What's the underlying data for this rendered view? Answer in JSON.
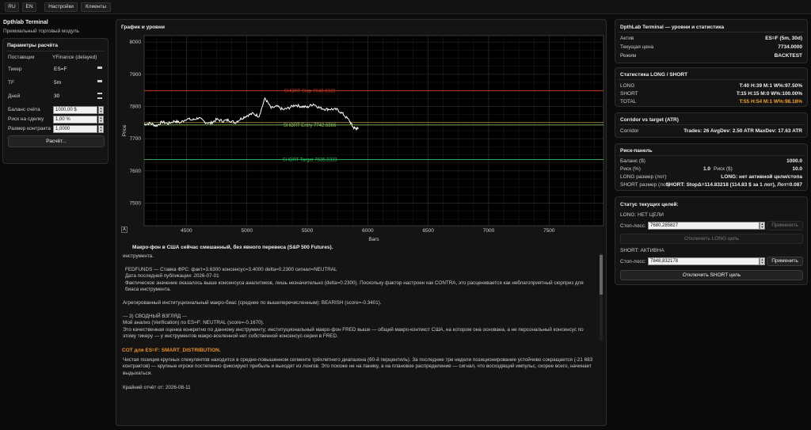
{
  "topbar": {
    "buttons": [
      {
        "label": "RU"
      },
      {
        "label": "EN"
      },
      {
        "label": "Настройки"
      },
      {
        "label": "Клиенты"
      }
    ]
  },
  "sidebar": {
    "title": "Dpthlab Terminal",
    "subtitle": "Премиальный торговый модуль",
    "params": {
      "title": "Параметры расчёта",
      "provider_label": "Поставщик",
      "provider_value": "YFinance (delayed)",
      "ticker_label": "Тикер",
      "ticker_value": "ES=F",
      "tf_label": "TF",
      "tf_value": "5m",
      "days_label": "Дней",
      "days_value": "30",
      "balance_label": "Баланс счёта",
      "balance_value": "1000,00 $",
      "risk_label": "Риск на сделку",
      "risk_value": "1,00 %",
      "contract_label": "Размер контракта",
      "contract_value": "1,0000",
      "calc_button": "Расчёт..."
    }
  },
  "center": {
    "chart_panel_title": "График и уровни",
    "chart_tool_label": "A",
    "analysis_title": "Макро-фон в США сейчас смешанный, без явного перевеса (S&P 500 Futures).",
    "analysis": {
      "p1": "инструмента.",
      "p2": "FEDFUNDS — Ставка ФРС: факт=3.6300  консенсус=3.4000  delta=0.2300  сигнал=NEUTRAL\n   Дата последней публикации: 2026-07-01\n   Фактическое значение оказалось выше консенсуса аналитиков, лишь незначительно (delta=0.2300). Поскольку фактор настроен как CONTRA, это расценивается как неблагоприятный сюрприз для\n   биаса инструмента.",
      "p3": "Агрегированный институциональный макро-биас (среднее по вышеперечисленным): BEARISH (score=-0.3401).",
      "p4": "--- 3) СВОДНЫЙ ВЗГЛЯД ---\nМой анализ (Verification) по ES=F: NEUTRAL (score=-0.1670).\nЭто качественная оценка конкретно по данному инструменту; институциональный макро-фон FRED выше — общий макро-контекст США, на котором она основана, а не персональный консенсус по\nэтому тикеру — у инструментов макро-вселенной нет собственной консенсус-серии в FRED.",
      "cot_title": "COT для ES=F: SMART_DISTRIBUTION.",
      "p5": "Чистая позиция крупных спекулянтов находится в средне-повышенном сегменте трёхлетнего диапазона (60-й перцентиль). За последние три недели позиционирование устойчиво сокращается (-21 683\nконтрактов) — крупные игроки постепенно фиксируют прибыль и выходят из лонгов. Это похоже не на панику, а на плановое распределение — сигнал, что восходящий импульс, скорее всего, начинает\nвыдыхаться.",
      "p6": "Крайний отчёт от: 2026-08-11"
    }
  },
  "right": {
    "levels": {
      "title": "DpthLab Terminal — уровни и статистика",
      "asset_label": "Актив",
      "asset_value": "ES=F (5m, 30d)",
      "price_label": "Текущая цена",
      "price_value": "7734.0000",
      "mode_label": "Режим",
      "mode_value": "BACKTEST"
    },
    "stats": {
      "title": "Статистика LONG / SHORT",
      "long_label": "LONG",
      "long_value": "T:40 H:39 M:1 W%:97.50%",
      "short_label": "SHORT",
      "short_value": "T:15 H:15 M:0 W%:100.00%",
      "total_label": "TOTAL",
      "total_value": "T:55 H:54 M:1 W%:98.18%"
    },
    "corridor": {
      "title": "Corridor vs target (ATR)",
      "label": "Corridor",
      "value": "Trades: 26  AvgDev: 2.50 ATR  MaxDev: 17.63 ATR"
    },
    "risk": {
      "title": "Риск-панель",
      "balance_label": "Баланс ($)",
      "balance_value": "1000.0",
      "risk_label": "Риск (%)",
      "risk_pct": "1.0",
      "risk_usd_label": "Риск ($)",
      "risk_usd": "10.0",
      "long_size_label": "LONG размер (лот)",
      "long_size_value": "LONG: нет активной цели/стопа",
      "short_size_label": "SHORT размер (лот)",
      "short_size_value": "SHORT: StopΔ=114.83218 (114.83 $ за 1 лот), Лот=0.087"
    },
    "targets": {
      "title": "Статус текущих целей:",
      "long_status": "LONG:  НЕТ ЦЕЛИ",
      "long_stop_label": "Стоп-лосс:",
      "long_stop_value": "7680,285827",
      "long_apply": "Применить",
      "long_disable": "Отключить LONG цель",
      "short_status": "SHORT: АКТИВНА",
      "short_stop_label": "Стоп-лосс:",
      "short_stop_value": "7848,832178",
      "short_apply": "Применить",
      "short_disable": "Отключить SHORT цель"
    }
  },
  "chart_data": {
    "type": "line",
    "xlabel": "Bars",
    "ylabel": "Price",
    "xlim": [
      4150,
      7950
    ],
    "ylim": [
      7430,
      8020
    ],
    "x_ticks": [
      4500,
      5000,
      5500,
      6000,
      6500,
      7000,
      7500
    ],
    "y_ticks": [
      7500,
      7600,
      7700,
      7800,
      7900,
      8000
    ],
    "grid": true,
    "colors": {
      "price": "#ffffff",
      "stop": "#c0392b",
      "entry": "#8fbf60",
      "target": "#2fbf5f"
    },
    "series": [
      {
        "x": [
          4150,
          4200,
          4250,
          4300,
          4350,
          4400,
          4450,
          4500,
          4550,
          4600,
          4650,
          4700,
          4750,
          4800,
          4850,
          4900,
          4950,
          5000,
          5050,
          5100,
          5150,
          5200,
          5250,
          5300,
          5350,
          5400,
          5450,
          5500,
          5550,
          5600,
          5650,
          5700,
          5750,
          5800,
          5850,
          5880,
          5900,
          5920
        ],
        "y": [
          7745,
          7748,
          7740,
          7752,
          7747,
          7755,
          7750,
          7762,
          7758,
          7765,
          7752,
          7748,
          7760,
          7755,
          7758,
          7750,
          7762,
          7772,
          7778,
          7770,
          7826,
          7795,
          7800,
          7790,
          7796,
          7805,
          7800,
          7798,
          7808,
          7796,
          7792,
          7792,
          7790,
          7775,
          7755,
          7735,
          7732,
          7730
        ]
      }
    ],
    "levels": [
      {
        "name": "SHORT Stop 7848.8322",
        "value": 7848.8322,
        "kind": "stop"
      },
      {
        "name": "SHORT Entry 7742.6866",
        "value": 7742.6866,
        "kind": "entry"
      },
      {
        "name": "SHORT Target 7635.3333",
        "value": 7635.3333,
        "kind": "target"
      }
    ]
  }
}
